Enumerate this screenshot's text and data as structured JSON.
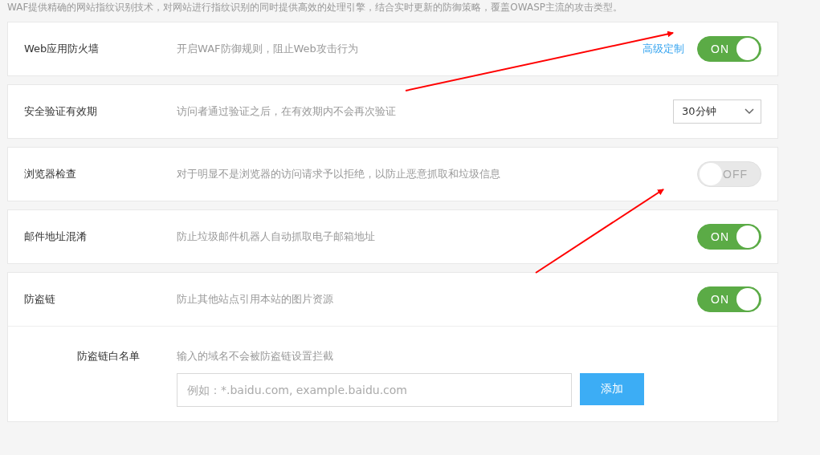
{
  "intro": "WAF提供精确的网站指纹识别技术，对网站进行指纹识别的同时提供高效的处理引擎，结合实时更新的防御策略，覆盖OWASP主流的攻击类型。",
  "settings": [
    {
      "kind": "toggle",
      "label": "Web应用防火墙",
      "description": "开启WAF防御规则，阻止Web攻击行为",
      "link": "高级定制",
      "on": true,
      "text": "ON"
    },
    {
      "kind": "select",
      "label": "安全验证有效期",
      "description": "访问者通过验证之后，在有效期内不会再次验证",
      "value": "30分钟"
    },
    {
      "kind": "toggle",
      "label": "浏览器检查",
      "description": "对于明显不是浏览器的访问请求予以拒绝，以防止恶意抓取和垃圾信息",
      "on": false,
      "text": "OFF"
    },
    {
      "kind": "toggle",
      "label": "邮件地址混淆",
      "description": "防止垃圾邮件机器人自动抓取电子邮箱地址",
      "on": true,
      "text": "ON"
    },
    {
      "kind": "toggle",
      "label": "防盗链",
      "description": "防止其他站点引用本站的图片资源",
      "on": true,
      "text": "ON",
      "whitelist": {
        "label": "防盗链白名单",
        "hint": "输入的域名不会被防盗链设置拦截",
        "placeholder": "例如：*.baidu.com, example.baidu.com",
        "button": "添加"
      }
    }
  ]
}
